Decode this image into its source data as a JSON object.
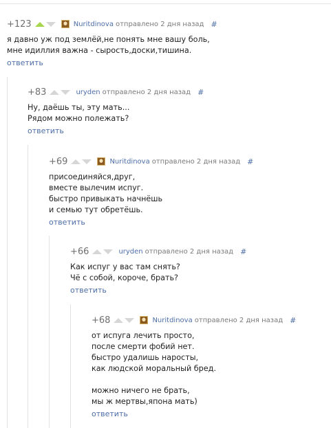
{
  "ui": {
    "reply_label": "ответить",
    "hash_label": "#",
    "posted_label": "отправлено 2 дня назад"
  },
  "comments": [
    {
      "rating": "+123",
      "author": "Nuritdinova",
      "has_avatar": true,
      "up_active": true,
      "lines": [
        "я давно уж под землёй,не понять мне вашу боль,",
        "мне идиллия важна - сырость,доски,тишина."
      ]
    },
    {
      "rating": "+83",
      "author": "uryden",
      "has_avatar": false,
      "up_active": false,
      "lines": [
        "Ну, даёшь ты, эту мать...",
        "Рядом можно полежать?"
      ]
    },
    {
      "rating": "+69",
      "author": "Nuritdinova",
      "has_avatar": true,
      "up_active": false,
      "lines": [
        "присоединяйся,друг,",
        "вместе вылечим испуг.",
        "быстро привыкать начнёшь",
        "и семью тут обретёшь."
      ]
    },
    {
      "rating": "+66",
      "author": "uryden",
      "has_avatar": false,
      "up_active": false,
      "lines": [
        "Как испуг у вас там снять?",
        "Чё с собой, короче, брать?"
      ]
    },
    {
      "rating": "+68",
      "author": "Nuritdinova",
      "has_avatar": true,
      "up_active": false,
      "lines": [
        "от испуга лечить просто,",
        "после смерти фобий нет.",
        "быстро удалишь нароcты,",
        "как людской моральный бред.",
        "",
        "можно ничего не брать,",
        "мы ж мертвы,япона мать)"
      ]
    }
  ]
}
